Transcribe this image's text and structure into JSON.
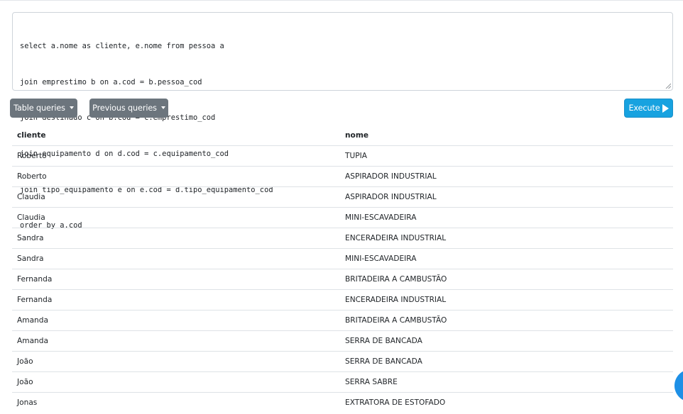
{
  "editor": {
    "query_lines": [
      "select a.nome as cliente, e.nome from pessoa a",
      "join emprestimo b on a.cod = b.pessoa_cod",
      "join destinado c on b.cod = c.emprestimo_cod",
      "join equipamento d on d.cod = c.equipamento_cod",
      "join tipo_equipamento e on e.cod = d.tipo_equipamento_cod",
      "order by a.cod"
    ]
  },
  "toolbar": {
    "table_queries_label": "Table queries",
    "previous_queries_label": "Previous queries",
    "execute_label": "Execute",
    "execute_icon": "play-icon",
    "dropdown_icon": "caret-down-icon"
  },
  "results": {
    "columns": [
      "cliente",
      "nome"
    ],
    "rows": [
      [
        "Roberto",
        "TUPIA"
      ],
      [
        "Roberto",
        "ASPIRADOR INDUSTRIAL"
      ],
      [
        "Claudia",
        "ASPIRADOR INDUSTRIAL"
      ],
      [
        "Claudia",
        "MINI-ESCAVADEIRA"
      ],
      [
        "Sandra",
        "ENCERADEIRA INDUSTRIAL"
      ],
      [
        "Sandra",
        "MINI-ESCAVADEIRA"
      ],
      [
        "Fernanda",
        "BRITADEIRA A CAMBUSTÃO"
      ],
      [
        "Fernanda",
        "ENCERADEIRA INDUSTRIAL"
      ],
      [
        "Amanda",
        "BRITADEIRA A CAMBUSTÃO"
      ],
      [
        "Amanda",
        "SERRA DE BANCADA"
      ],
      [
        "João",
        "SERRA DE BANCADA"
      ],
      [
        "João",
        "SERRA SABRE"
      ],
      [
        "Jonas",
        "EXTRATORA DE ESTOFADO"
      ]
    ]
  },
  "colors": {
    "secondary_button": "#6c757d",
    "execute_button": "#17a2e0",
    "fab": "#1e90e6"
  }
}
